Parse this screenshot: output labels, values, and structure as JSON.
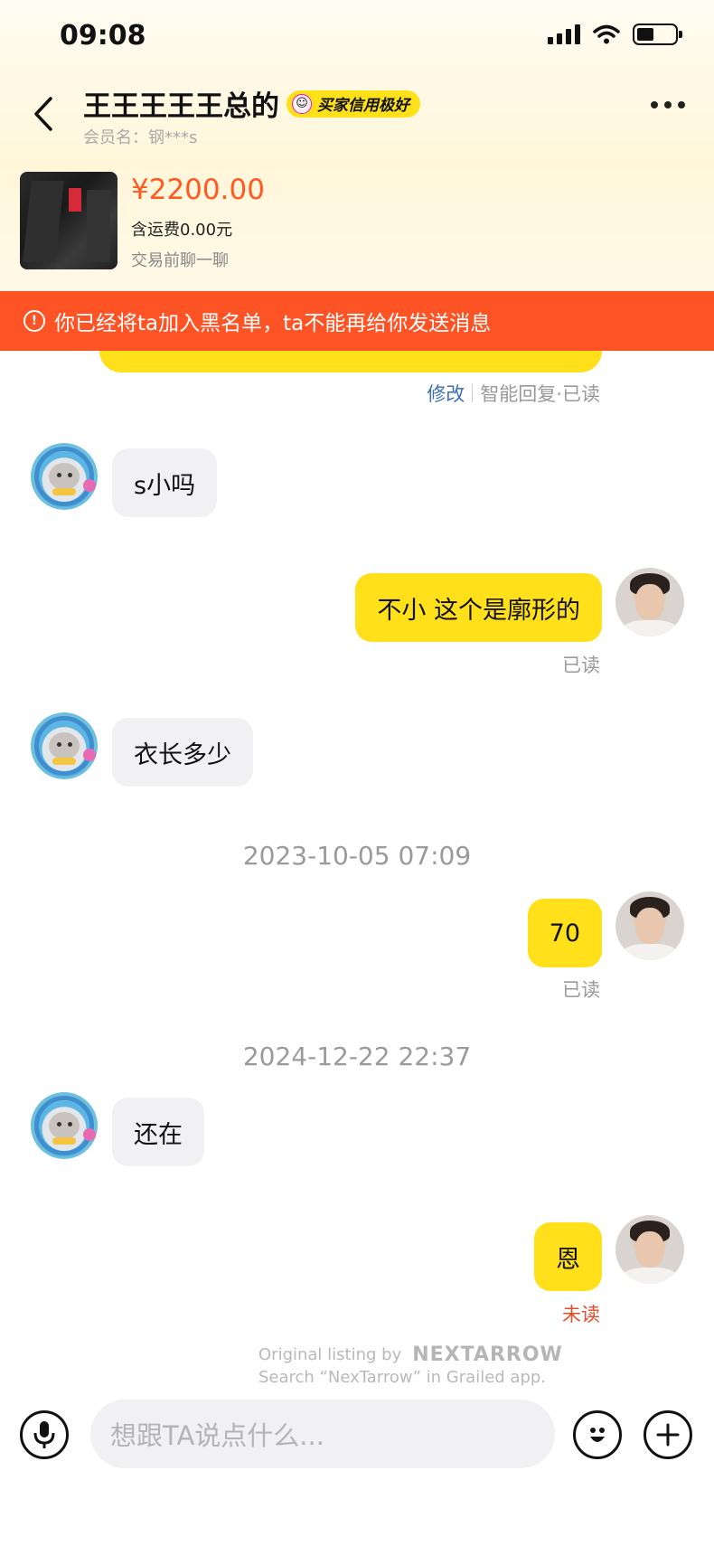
{
  "status_bar": {
    "time": "09:08"
  },
  "header": {
    "title": "王王王王王总的",
    "credit_badge": "买家信用极好",
    "member": "会员名：钢***s"
  },
  "product": {
    "price": "¥2200.00",
    "shipping": "含运费0.00元",
    "note": "交易前聊一聊"
  },
  "banner": {
    "icon": "!",
    "text": "你已经将ta加入黑名单，ta不能再给你发送消息"
  },
  "meta_row": {
    "edit": "修改",
    "status": "智能回复·已读"
  },
  "messages": [
    {
      "side": "in",
      "text": "s小吗"
    },
    {
      "side": "out",
      "text": "不小 这个是廓形的",
      "status": "已读"
    },
    {
      "side": "in",
      "text": "衣长多少"
    },
    {
      "timestamp": "2023-10-05 07:09"
    },
    {
      "side": "out",
      "text": "70",
      "status": "已读"
    },
    {
      "timestamp": "2024-12-22 22:37"
    },
    {
      "side": "in",
      "text": "还在"
    },
    {
      "side": "out",
      "text": "恩",
      "status": "未读"
    }
  ],
  "watermark": {
    "line1": "Original listing by",
    "brand": "NEXTARROW",
    "line2": "Search “NexTarrow” in Grailed app."
  },
  "input": {
    "placeholder": "想跟TA说点什么...",
    "mic_icon": "microphone-icon",
    "emoji_icon": "emoji-icon",
    "plus_icon": "plus-icon"
  },
  "colors": {
    "accent_yellow": "#ffe01b",
    "banner_orange": "#fe5425",
    "price_orange": "#ff5a1f",
    "unread_red": "#e24d2a"
  }
}
